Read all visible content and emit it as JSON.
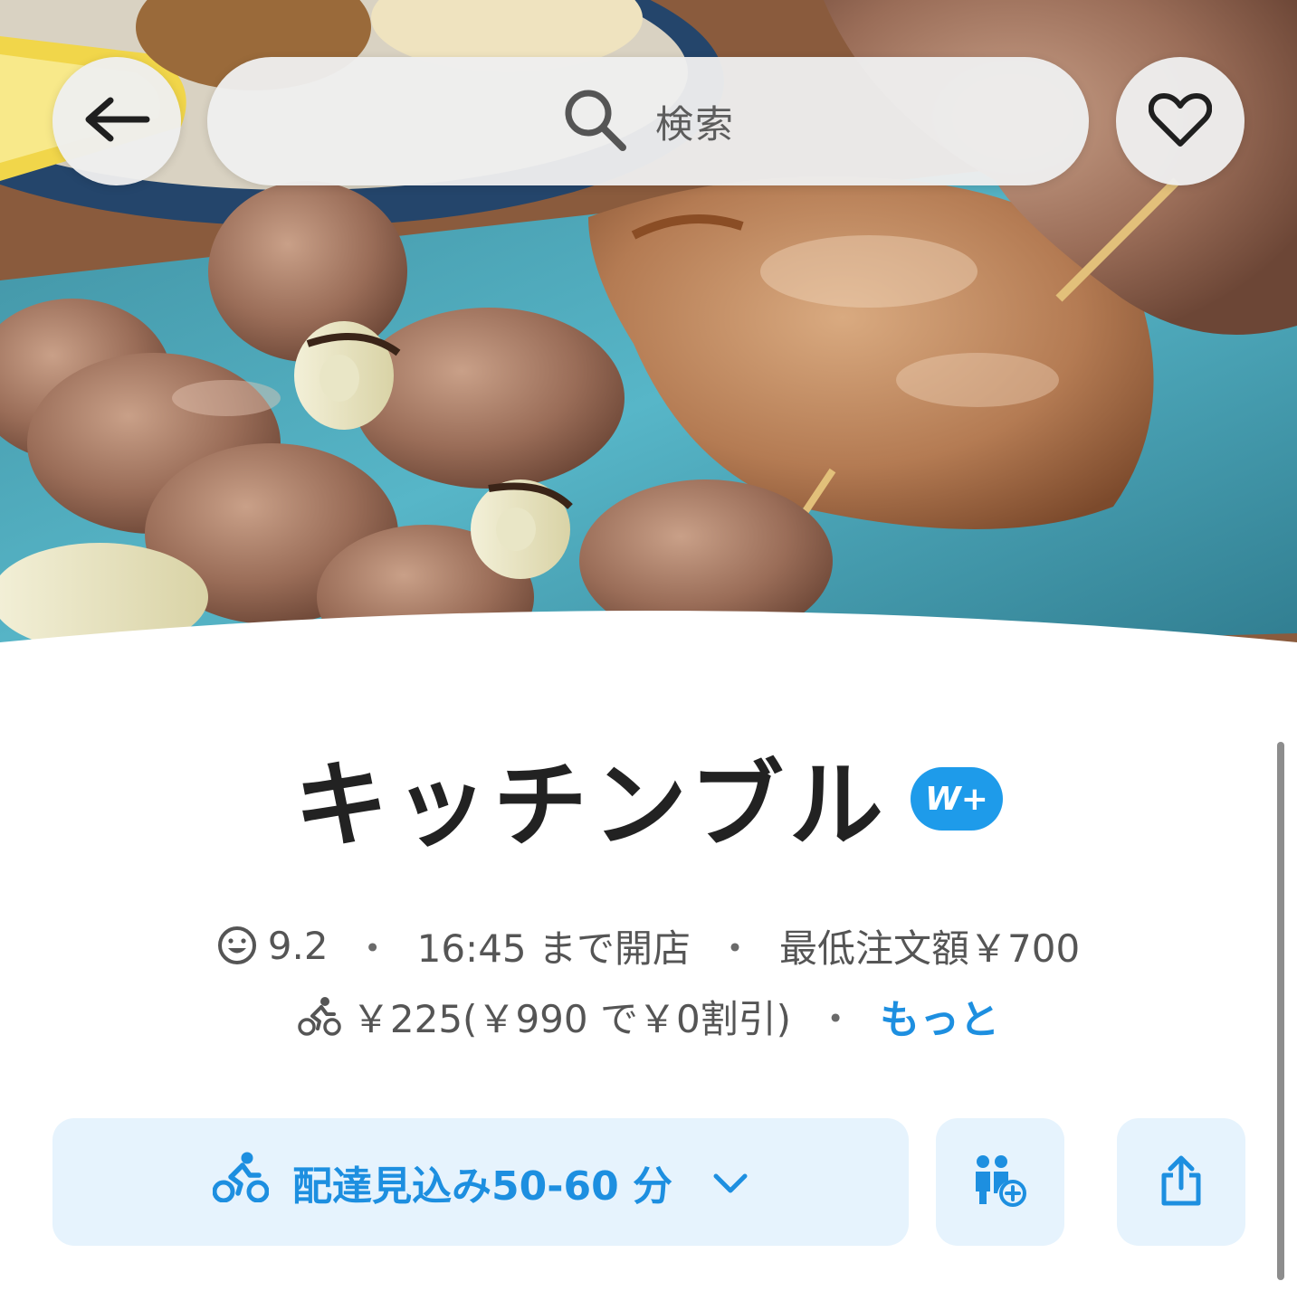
{
  "header": {
    "back_icon": "arrow-left-icon",
    "search_icon": "search-icon",
    "search_placeholder": "検索",
    "favorite_icon": "heart-icon"
  },
  "store": {
    "name": "キッチンブル",
    "badge": "W+",
    "rating_icon": "smiley-icon",
    "rating": "9.2",
    "hours": "16:45 まで開店",
    "min_order": "最低注文額￥700",
    "delivery_icon": "cyclist-icon",
    "delivery_fee": "￥225(￥990 で￥0割引)",
    "more_link": "もっと",
    "separator": "・"
  },
  "actions": {
    "delivery_estimate": "配達見込み50-60 分",
    "delivery_icon": "cyclist-icon",
    "chevron_icon": "chevron-down-icon",
    "group_order_icon": "group-order-icon",
    "share_icon": "share-icon"
  },
  "colors": {
    "accent": "#1d8fe0",
    "badge": "#1e9bea",
    "button_bg": "#e6f3fd",
    "title": "#222222"
  }
}
